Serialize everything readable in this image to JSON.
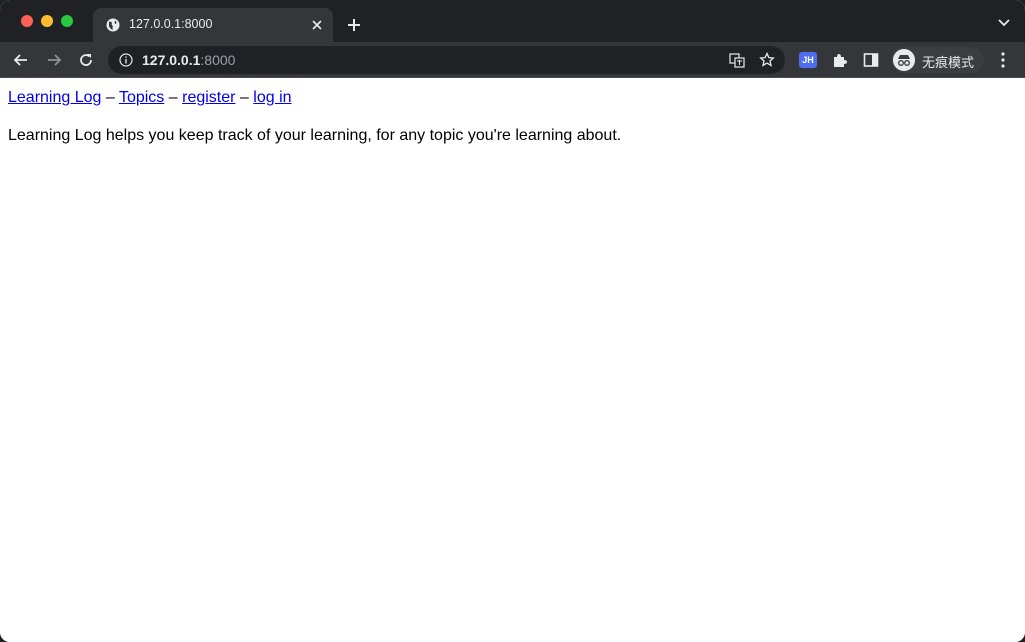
{
  "browser": {
    "tab": {
      "title": "127.0.0.1:8000",
      "favicon": "globe-icon"
    },
    "address": {
      "host": "127.0.0.1",
      "port": ":8000"
    },
    "extension_label": "JH",
    "incognito_label": "无痕模式"
  },
  "page": {
    "nav": [
      {
        "label": "Learning Log"
      },
      {
        "label": "Topics"
      },
      {
        "label": "register"
      },
      {
        "label": "log in"
      }
    ],
    "separator": "–",
    "intro": "Learning Log helps you keep track of your learning, for any topic you're learning about."
  },
  "colors": {
    "link": "#0000ee",
    "chrome_dark": "#202124",
    "chrome_toolbar": "#35363a"
  }
}
